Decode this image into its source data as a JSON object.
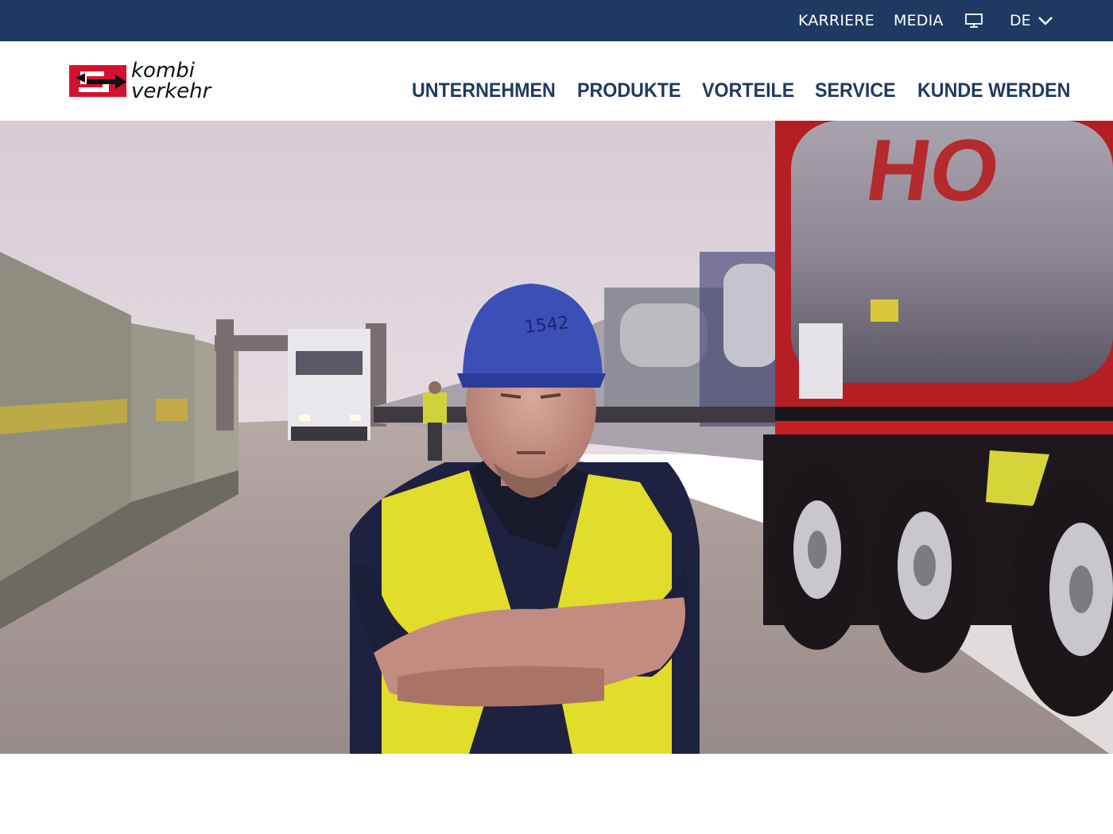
{
  "topbar": {
    "links": [
      {
        "label": "KARRIERE"
      },
      {
        "label": "MEDIA"
      }
    ],
    "monitor_icon": "monitor-icon",
    "language": {
      "selected": "DE",
      "icon": "chevron-down-icon"
    }
  },
  "header": {
    "logo": {
      "line1": "kombi",
      "line2": "verkehr"
    },
    "nav": [
      {
        "label": "UNTERNEHMEN"
      },
      {
        "label": "PRODUKTE"
      },
      {
        "label": "VORTEILE"
      },
      {
        "label": "SERVICE"
      },
      {
        "label": "KUNDE WERDEN"
      }
    ]
  },
  "hero": {
    "helmet_text": "1542",
    "tank_text": "HO"
  },
  "colors": {
    "brand_navy": "#1e3a62",
    "brand_red": "#d3122f",
    "white": "#ffffff"
  }
}
